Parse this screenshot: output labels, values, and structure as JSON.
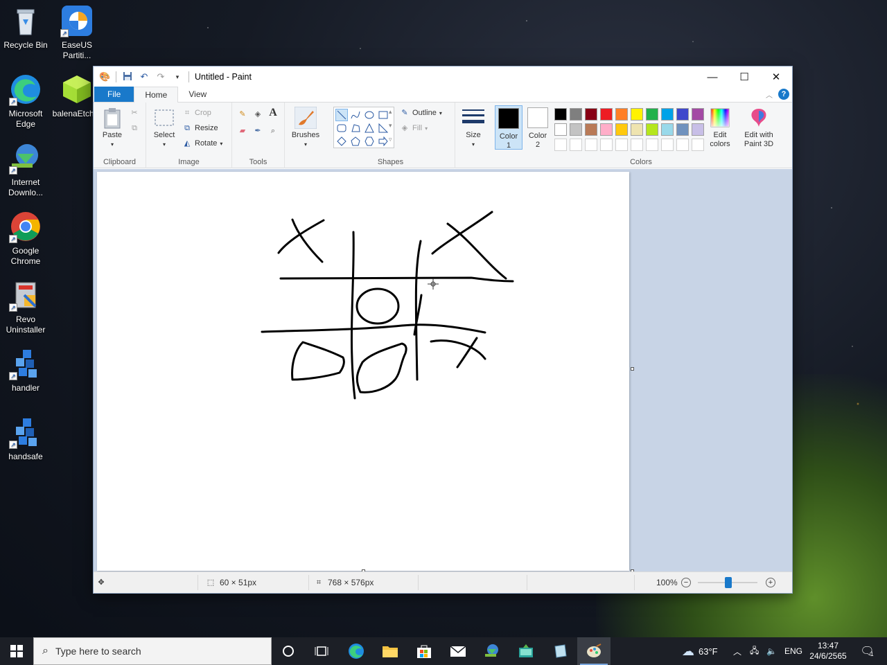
{
  "desktop": {
    "icons": [
      {
        "label": "Recycle Bin"
      },
      {
        "label": "EaseUS Partiti..."
      },
      {
        "label": "Microsoft Edge"
      },
      {
        "label": "balenaEtcher"
      },
      {
        "label": "Internet Downlo..."
      },
      {
        "label": "Google Chrome"
      },
      {
        "label": "Revo Uninstaller"
      },
      {
        "label": "handler"
      },
      {
        "label": "handsafe"
      }
    ]
  },
  "window": {
    "title": "Untitled - Paint",
    "tabs": {
      "file": "File",
      "home": "Home",
      "view": "View"
    },
    "help": "?"
  },
  "ribbon": {
    "clipboard": {
      "group": "Clipboard",
      "paste": "Paste"
    },
    "image": {
      "group": "Image",
      "select": "Select",
      "crop": "Crop",
      "resize": "Resize",
      "rotate": "Rotate"
    },
    "tools": {
      "group": "Tools"
    },
    "brushes": {
      "label": "Brushes"
    },
    "shapes": {
      "group": "Shapes",
      "outline": "Outline",
      "fill": "Fill"
    },
    "size": {
      "label": "Size"
    },
    "colors": {
      "group": "Colors",
      "color1": "Color 1",
      "color2": "Color 2",
      "edit_colors": "Edit colors",
      "edit_paint3d": "Edit with Paint 3D",
      "color1_value": "#000000",
      "color2_value": "#ffffff",
      "palette_row1": [
        "#000000",
        "#7f7f7f",
        "#880015",
        "#ed1c24",
        "#ff7f27",
        "#fff200",
        "#22b14c",
        "#00a2e8",
        "#3f48cc",
        "#a349a4"
      ],
      "palette_row2": [
        "#ffffff",
        "#c3c3c3",
        "#b97a57",
        "#ffaec9",
        "#ffc90e",
        "#efe4b0",
        "#b5e61d",
        "#99d9ea",
        "#7092be",
        "#c8bfe7"
      ],
      "palette_row3": [
        "#ffffff",
        "#ffffff",
        "#ffffff",
        "#ffffff",
        "#ffffff",
        "#ffffff",
        "#ffffff",
        "#ffffff",
        "#ffffff",
        "#ffffff"
      ]
    }
  },
  "status": {
    "selection_size": "60 × 51px",
    "image_size": "768 × 576px",
    "zoom": "100%",
    "zoom_minus": "−",
    "zoom_plus": "+"
  },
  "taskbar": {
    "search_placeholder": "Type here to search",
    "weather": "63°F",
    "language": "ENG",
    "time": "13:47",
    "date": "24/6/2565",
    "notifications": "1"
  }
}
